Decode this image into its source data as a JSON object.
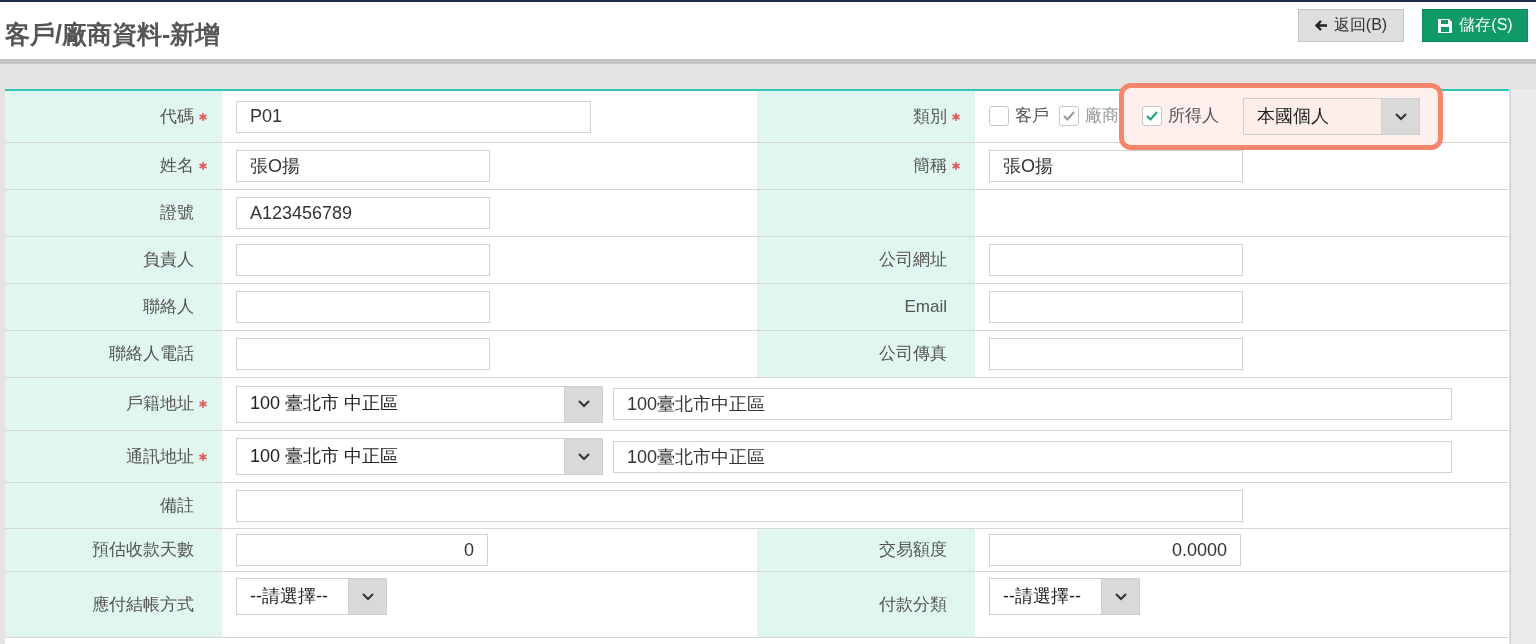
{
  "page": {
    "title": "客戶/廠商資料-新增"
  },
  "buttons": [
    {
      "kind": "back",
      "label": "返回(B)"
    },
    {
      "kind": "save",
      "label": "儲存(S)"
    }
  ],
  "rows": [
    {
      "fields": [
        {
          "kind": "long-text",
          "label": "代碼",
          "required": true,
          "value": "P01"
        },
        {
          "kind": "category",
          "label": "類別",
          "required": true,
          "highlight": true,
          "options": [
            {
              "label": "客戶",
              "checked": false,
              "disabled": false
            },
            {
              "label": "廠商",
              "checked": true,
              "disabled": true
            },
            {
              "label": "所得人",
              "checked": true,
              "disabled": false
            }
          ],
          "select": "本國個人"
        }
      ]
    },
    {
      "fields": [
        {
          "kind": "text",
          "label": "姓名",
          "required": true,
          "value": "張O揚"
        },
        {
          "kind": "text",
          "label": "簡稱",
          "required": true,
          "value": "張O揚"
        }
      ]
    },
    {
      "fields": [
        {
          "kind": "text",
          "label": "證號",
          "required": false,
          "value": "A123456789"
        },
        {
          "kind": "blank",
          "required": false
        }
      ]
    },
    {
      "fields": [
        {
          "kind": "text",
          "label": "負責人",
          "required": false
        },
        {
          "kind": "text",
          "label": "公司網址",
          "required": false
        }
      ]
    },
    {
      "fields": [
        {
          "kind": "text",
          "label": "聯絡人",
          "required": false
        },
        {
          "kind": "text",
          "label": "Email",
          "required": false
        }
      ]
    },
    {
      "fields": [
        {
          "kind": "text",
          "label": "聯絡人電話",
          "required": false
        },
        {
          "kind": "text",
          "label": "公司傳真",
          "required": false
        }
      ]
    },
    {
      "fields": [
        {
          "kind": "address",
          "label": "戶籍地址",
          "required": true,
          "select": "100 臺北市 中正區",
          "value": "100臺北市中正區"
        }
      ]
    },
    {
      "fields": [
        {
          "kind": "address",
          "label": "通訊地址",
          "required": true,
          "select": "100 臺北市 中正區",
          "value": "100臺北市中正區"
        }
      ]
    },
    {
      "fields": [
        {
          "kind": "note",
          "label": "備註",
          "required": false
        }
      ]
    },
    {
      "fields": [
        {
          "kind": "number",
          "label": "預估收款天數",
          "required": false,
          "value": "0"
        },
        {
          "kind": "number",
          "label": "交易額度",
          "required": false,
          "value": "0.0000"
        }
      ]
    },
    {
      "fields": [
        {
          "kind": "select",
          "label": "應付結帳方式",
          "required": false,
          "select": "--請選擇--"
        },
        {
          "kind": "select",
          "label": "付款分類",
          "required": false,
          "select": "--請選擇--"
        }
      ]
    }
  ]
}
